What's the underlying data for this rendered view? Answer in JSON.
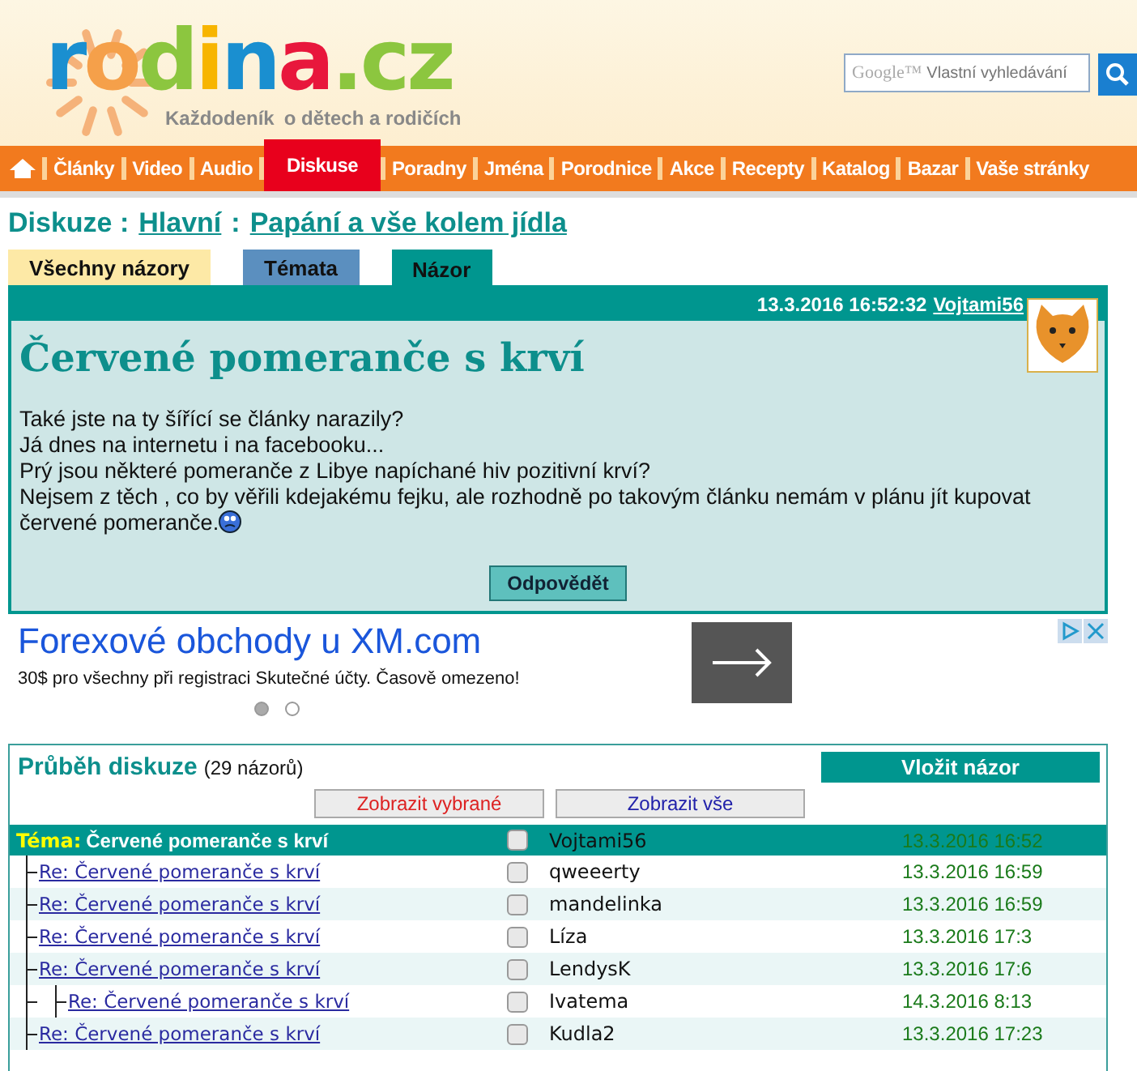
{
  "logo": {
    "letters": [
      {
        "text": "r",
        "color": "#1a8fd0"
      },
      {
        "text": "o",
        "color": "#f5a04a"
      },
      {
        "text": "d",
        "color": "#8cc63f"
      },
      {
        "text": "i",
        "color": "#f7b500"
      },
      {
        "text": "n",
        "color": "#1a8fd0"
      },
      {
        "text": "a",
        "color": "#e8173c"
      },
      {
        "text": ".cz",
        "color": "#8cc63f"
      }
    ],
    "tagline_left": "Každodeník",
    "tagline_right": "o dětech a rodičích"
  },
  "search": {
    "brand": "Google™",
    "placeholder": "Vlastní vyhledávání"
  },
  "nav": [
    {
      "label": "Články",
      "selected": false
    },
    {
      "label": "Video",
      "selected": false
    },
    {
      "label": "Audio",
      "selected": false
    },
    {
      "label": "Diskuse",
      "selected": true
    },
    {
      "label": "Poradny",
      "selected": false
    },
    {
      "label": "Jména",
      "selected": false
    },
    {
      "label": "Porodnice",
      "selected": false
    },
    {
      "label": "Akce",
      "selected": false
    },
    {
      "label": "Recepty",
      "selected": false
    },
    {
      "label": "Katalog",
      "selected": false
    },
    {
      "label": "Bazar",
      "selected": false
    },
    {
      "label": "Vaše stránky",
      "selected": false
    }
  ],
  "breadcrumb": {
    "prefix": "Diskuze :",
    "separator": ":",
    "links": [
      "Hlavní",
      "Papání a vše kolem jídla"
    ]
  },
  "tabs": [
    {
      "label": "Všechny názory",
      "color": "#fde9a6",
      "selected": false
    },
    {
      "label": "Témata",
      "color": "#5b8fbf",
      "selected": false
    },
    {
      "label": "Názor",
      "color": "#00968f",
      "selected": true
    }
  ],
  "post": {
    "datetime": "13.3.2016 16:52:32",
    "author": "Vojtami56",
    "title": "Červené pomeranče s krví",
    "lines": [
      "Také jste na ty šířící se články narazily?",
      "Já dnes na internetu i na facebooku...",
      "Prý jsou některé pomeranče z Libye napíchané hiv pozitivní krví?",
      "Nejsem z těch , co by věřili kdejakému fejku, ale rozhodně po takovým článku nemám v plánu jít kupovat červené pomeranče."
    ],
    "reply_button": "Odpovědět"
  },
  "ad": {
    "title": "Forexové obchody u XM.com",
    "text": "30$ pro všechny při registraci Skutečné účty. Časově omezeno!",
    "dots": [
      {
        "selected": true
      },
      {
        "selected": false
      }
    ]
  },
  "discussion": {
    "title": "Průběh diskuze",
    "count": "(29 názorů)",
    "add_button": "Vložit názor",
    "show_selected": "Zobrazit vybrané",
    "show_all": "Zobrazit vše",
    "topic": {
      "prefix": "Téma:",
      "title": "Červené pomeranče s krví",
      "checked": false,
      "author": "Vojtami56",
      "date": "13.3.2016 16:52",
      "children": [
        {
          "title": "Re: Červené pomeranče s krví",
          "checked": false,
          "author": "qweeerty",
          "date": "13.3.2016 16:59"
        },
        {
          "title": "Re: Červené pomeranče s krví",
          "checked": false,
          "author": "mandelinka",
          "date": "13.3.2016 16:59"
        },
        {
          "title": "Re: Červené pomeranče s krví",
          "checked": false,
          "author": "Líza",
          "date": "13.3.2016 17:3"
        },
        {
          "title": "Re: Červené pomeranče s krví",
          "checked": false,
          "author": "LendysK",
          "date": "13.3.2016 17:6",
          "children": [
            {
              "title": "Re: Červené pomeranče s krví",
              "checked": false,
              "author": "Ivatema",
              "date": "14.3.2016 8:13"
            }
          ]
        },
        {
          "title": "Re: Červené pomeranče s krví",
          "checked": false,
          "author": "Kudla2",
          "date": "13.3.2016 17:23"
        }
      ]
    }
  }
}
